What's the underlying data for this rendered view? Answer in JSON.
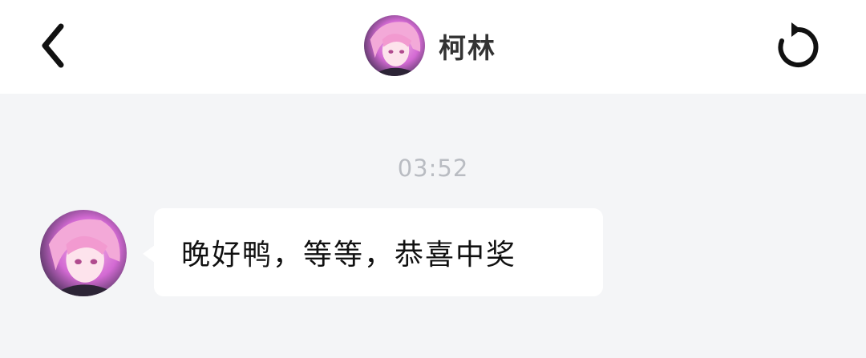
{
  "header": {
    "back_icon": "chevron-left-icon",
    "title": "柯林",
    "avatar_icon": "avatar",
    "refresh_icon": "refresh-icon"
  },
  "chat": {
    "timestamp": "03:52",
    "messages": [
      {
        "sender": "柯林",
        "text": "晚好鸭，等等，恭喜中奖"
      }
    ]
  },
  "colors": {
    "header_bg": "#ffffff",
    "chat_bg": "#f4f5f7",
    "bubble_bg": "#ffffff",
    "timestamp": "#b9bcc2",
    "title": "#333333"
  }
}
